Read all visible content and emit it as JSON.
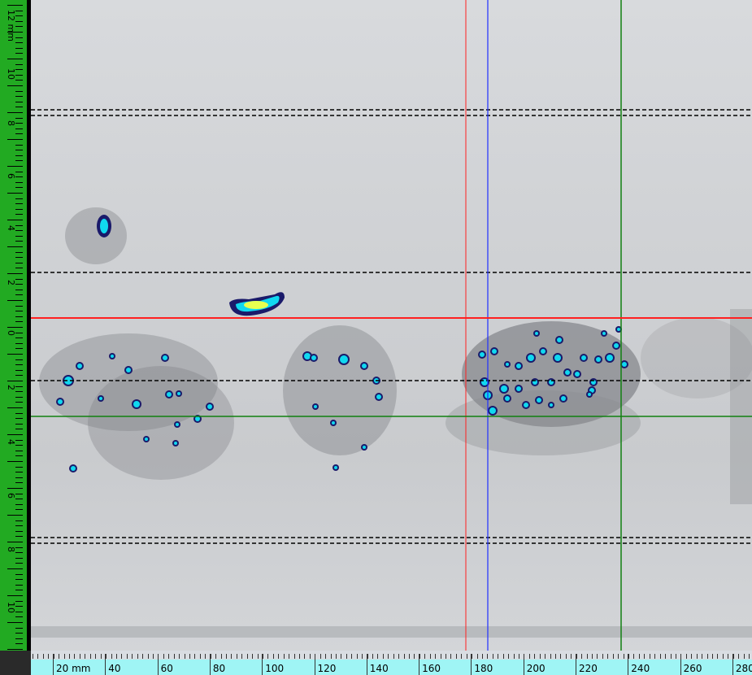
{
  "vertical_ruler": {
    "labels": [
      "12 mm",
      "10",
      "8",
      "6",
      "4",
      "2",
      "0",
      "2",
      "4",
      "6",
      "8",
      "10"
    ],
    "color": "#22aa22"
  },
  "horizontal_ruler": {
    "labels": [
      "20 mm",
      "40",
      "60",
      "80",
      "100",
      "120",
      "140",
      "160",
      "180",
      "200",
      "220",
      "240",
      "260",
      "280"
    ],
    "color": "#9ff5f5"
  },
  "cursors": {
    "red": "#ff2020",
    "blue": "#2030ff",
    "green": "#108010",
    "gate": "#000000"
  },
  "palette": {
    "background": "#d3d5d8",
    "dark_indication": "#1a1a6a",
    "cyan_indication": "#10d8f0",
    "yellow_indication": "#e8ff50"
  }
}
